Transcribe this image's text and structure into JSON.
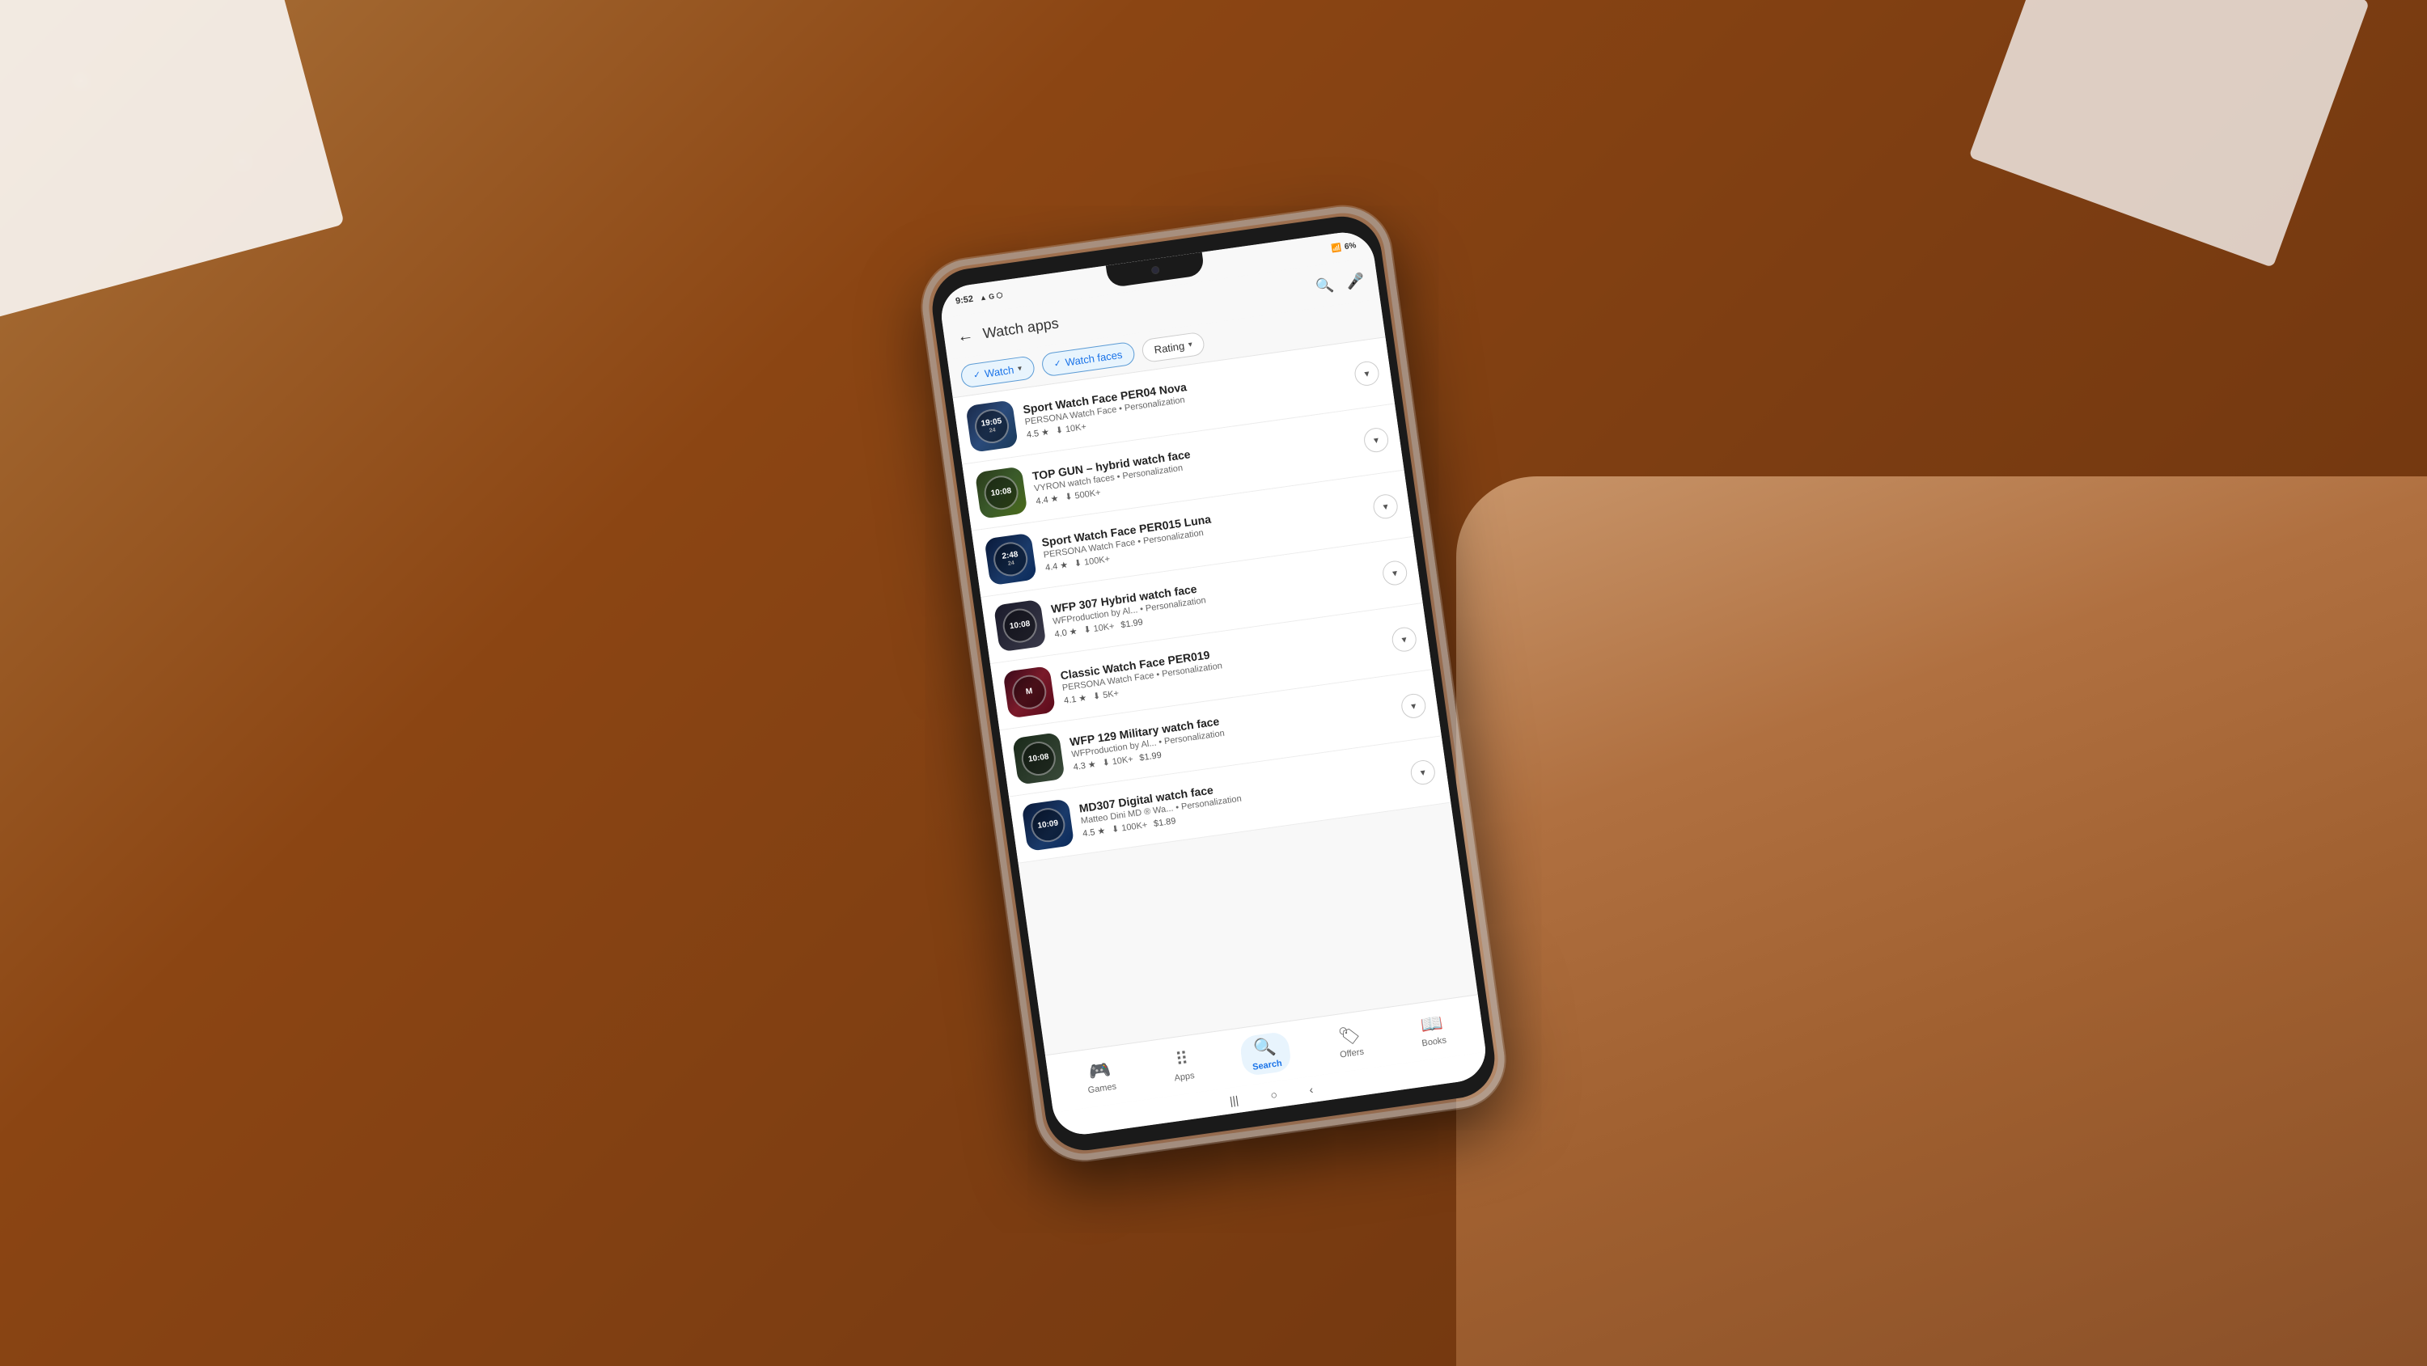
{
  "scene": {
    "background_color": "#8B4513"
  },
  "status_bar": {
    "time": "9:52",
    "battery": "6%",
    "signal_icons": "▲G⬡ ⚪"
  },
  "header": {
    "title": "Watch apps",
    "back_label": "←",
    "search_icon": "search",
    "mic_icon": "mic"
  },
  "filters": [
    {
      "label": "Watch",
      "active": true,
      "has_check": true,
      "has_arrow": true
    },
    {
      "label": "Watch faces",
      "active": true,
      "has_check": true,
      "has_arrow": false
    },
    {
      "label": "Rating",
      "active": false,
      "has_check": false,
      "has_arrow": true
    }
  ],
  "apps": [
    {
      "name": "Sport Watch Face PER04 Nova",
      "developer": "PERSONA Watch Face • Personalization",
      "rating": "4.5",
      "downloads": "10K+",
      "price": "",
      "icon_style": "sport1",
      "watch_time": "19:05",
      "watch_date": "24"
    },
    {
      "name": "TOP GUN – hybrid watch face",
      "developer": "VYRON watch faces • Personalization",
      "rating": "4.4",
      "downloads": "500K+",
      "price": "",
      "icon_style": "topgun",
      "watch_time": "10:08",
      "watch_date": ""
    },
    {
      "name": "Sport Watch Face PER015 Luna",
      "developer": "PERSONA Watch Face • Personalization",
      "rating": "4.4",
      "downloads": "100K+",
      "price": "",
      "icon_style": "sport15",
      "watch_time": "2:48",
      "watch_date": "24"
    },
    {
      "name": "WFP 307 Hybrid watch face",
      "developer": "WFProduction by Al... • Personalization",
      "rating": "4.0",
      "downloads": "10K+",
      "price": "$1.99",
      "icon_style": "wfp307",
      "watch_time": "10:08",
      "watch_date": ""
    },
    {
      "name": "Classic Watch Face PER019",
      "developer": "PERSONA Watch Face • Personalization",
      "rating": "4.1",
      "downloads": "5K+",
      "price": "",
      "icon_style": "classic",
      "watch_time": "M",
      "watch_date": ""
    },
    {
      "name": "WFP 129 Military watch face",
      "developer": "WFProduction by Al... • Personalization",
      "rating": "4.3",
      "downloads": "10K+",
      "price": "$1.99",
      "icon_style": "wfp129",
      "watch_time": "10:08",
      "watch_date": ""
    },
    {
      "name": "MD307 Digital watch face",
      "developer": "Matteo Dini MD ® Wa... • Personalization",
      "rating": "4.5",
      "downloads": "100K+",
      "price": "$1.89",
      "icon_style": "md307",
      "watch_time": "10:09",
      "watch_date": ""
    }
  ],
  "bottom_nav": [
    {
      "label": "Games",
      "icon": "🎮",
      "active": false
    },
    {
      "label": "Apps",
      "icon": "⠿",
      "active": false
    },
    {
      "label": "Search",
      "icon": "🔍",
      "active": true
    },
    {
      "label": "Offers",
      "icon": "🏷",
      "active": false
    },
    {
      "label": "Books",
      "icon": "📖",
      "active": false
    }
  ],
  "sys_nav": {
    "menu": "|||",
    "home": "○",
    "back": "‹"
  }
}
